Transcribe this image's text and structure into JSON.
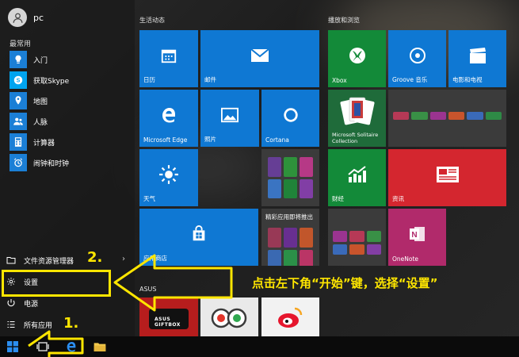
{
  "user": {
    "name": "pc"
  },
  "left": {
    "section_label": "最常用",
    "apps": [
      {
        "label": "入门",
        "icon": "lightbulb-icon",
        "color": "#1b7fd6"
      },
      {
        "label": "获取Skype",
        "icon": "skype-icon",
        "color": "#00a4ef"
      },
      {
        "label": "地图",
        "icon": "map-icon",
        "color": "#1b7fd6"
      },
      {
        "label": "人脉",
        "icon": "people-icon",
        "color": "#1b7fd6"
      },
      {
        "label": "计算器",
        "icon": "calculator-icon",
        "color": "#1b7fd6"
      },
      {
        "label": "闹钟和时钟",
        "icon": "alarm-icon",
        "color": "#1b7fd6"
      }
    ],
    "bottom": [
      {
        "label": "文件资源管理器",
        "icon": "folder-icon",
        "has_chevron": true
      },
      {
        "label": "设置",
        "icon": "gear-icon"
      },
      {
        "label": "电源",
        "icon": "power-icon"
      },
      {
        "label": "所有应用",
        "icon": "list-icon"
      }
    ]
  },
  "groups": [
    {
      "label": "生活动态"
    },
    {
      "label": "播放和浏览"
    },
    {
      "label": "ASUS"
    }
  ],
  "tiles": {
    "calendar": "日历",
    "mail": "邮件",
    "edge": "Microsoft Edge",
    "photos": "照片",
    "cortana": "Cortana",
    "weather": "天气",
    "live_tile_1": "精彩应用即将推出",
    "store": "应用商店",
    "xbox": "Xbox",
    "groove": "Groove 音乐",
    "movies": "电影和电视",
    "solitaire": "Microsoft Solitaire Collection",
    "finance": "财经",
    "news": "资讯",
    "onenote": "OneNote",
    "asus_giftbox": "ASUS GIFTBOX"
  },
  "annotation": {
    "callout": "点击左下角“开始”键，选择“设置”",
    "step1": "1.",
    "step2": "2.",
    "highlight_color": "#ffe600"
  },
  "colors": {
    "tile_blue": "#0f78d3",
    "tile_green": "#138a39",
    "tile_red": "#d4262f",
    "onenote": "#b12a6b"
  }
}
